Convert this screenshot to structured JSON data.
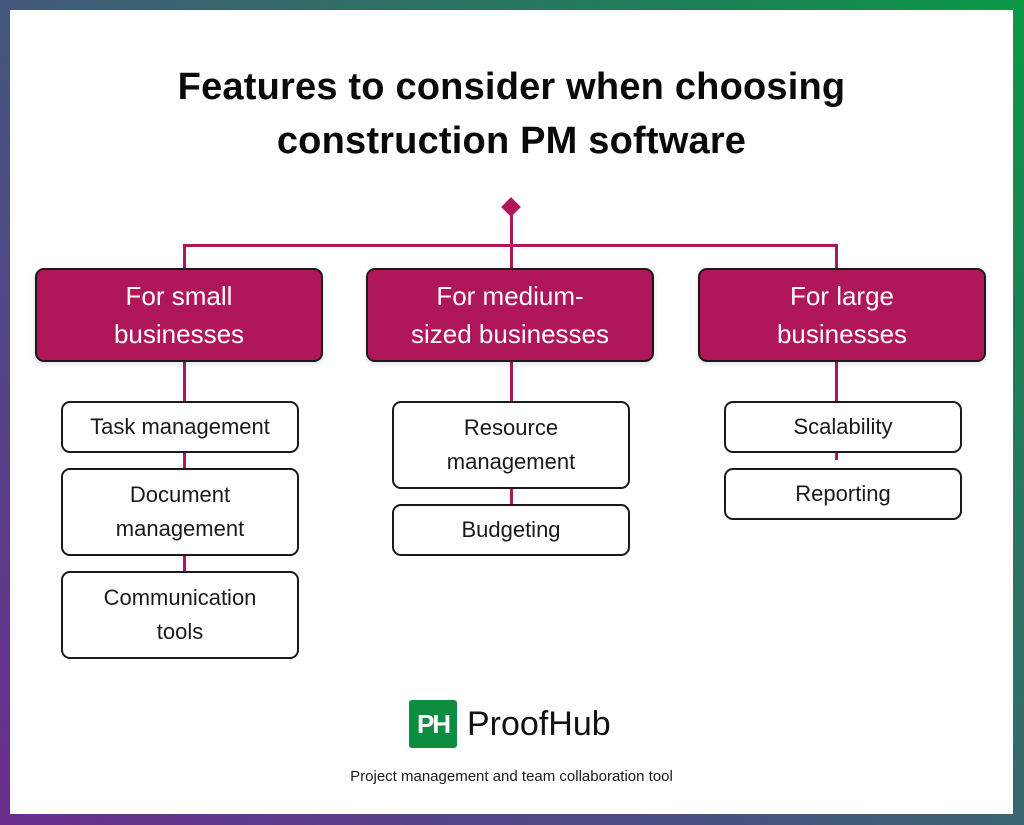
{
  "title": {
    "line1": "Features to consider when choosing",
    "line2": "construction PM software"
  },
  "colors": {
    "accent": "#b0175a",
    "border": "#1a1a1a",
    "logo_green": "#0d8d3f",
    "frame_gradient": [
      "#6a2d8c",
      "#2f6b6b",
      "#0a9a46"
    ]
  },
  "categories": [
    {
      "label_line1": "For small",
      "label_line2": "businesses",
      "features": [
        "Task management",
        "Document management",
        "Communication tools"
      ]
    },
    {
      "label_line1": "For medium-",
      "label_line2": "sized businesses",
      "features": [
        "Resource management",
        "Budgeting"
      ]
    },
    {
      "label_line1": "For large",
      "label_line2": "businesses",
      "features": [
        "Scalability",
        "Reporting"
      ]
    }
  ],
  "branding": {
    "logo_icon": "PH",
    "logo_name": "ProofHub",
    "tagline": "Project management and team collaboration tool"
  }
}
